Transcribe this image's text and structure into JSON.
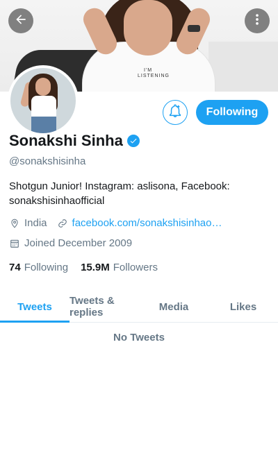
{
  "colors": {
    "accent": "#1da1f2",
    "text_primary": "#14171a",
    "text_secondary": "#657786"
  },
  "header": {
    "back_icon": "arrow-left-icon",
    "menu_icon": "more-vertical-icon",
    "banner_shirt_text": "I'M LISTENING"
  },
  "profile": {
    "name": "Sonakshi Sinha",
    "verified_icon": "verified-badge-icon",
    "handle": "@sonakshisinha",
    "bio": "Shotgun Junior! Instagram: aslisona, Facebook: sonakshisinhaofficial",
    "location": "India",
    "location_icon": "location-pin-icon",
    "link": "facebook.com/sonakshisinhao…",
    "link_icon": "link-icon",
    "joined": "Joined December 2009",
    "joined_icon": "calendar-icon"
  },
  "actions": {
    "notify_icon": "bell-plus-icon",
    "follow_label": "Following"
  },
  "stats": {
    "following_count": "74",
    "following_label": "Following",
    "followers_count": "15.9M",
    "followers_label": "Followers"
  },
  "tabs": [
    {
      "label": "Tweets",
      "active": true
    },
    {
      "label": "Tweets & replies",
      "active": false
    },
    {
      "label": "Media",
      "active": false
    },
    {
      "label": "Likes",
      "active": false
    }
  ],
  "timeline": {
    "empty_text": "No Tweets"
  }
}
